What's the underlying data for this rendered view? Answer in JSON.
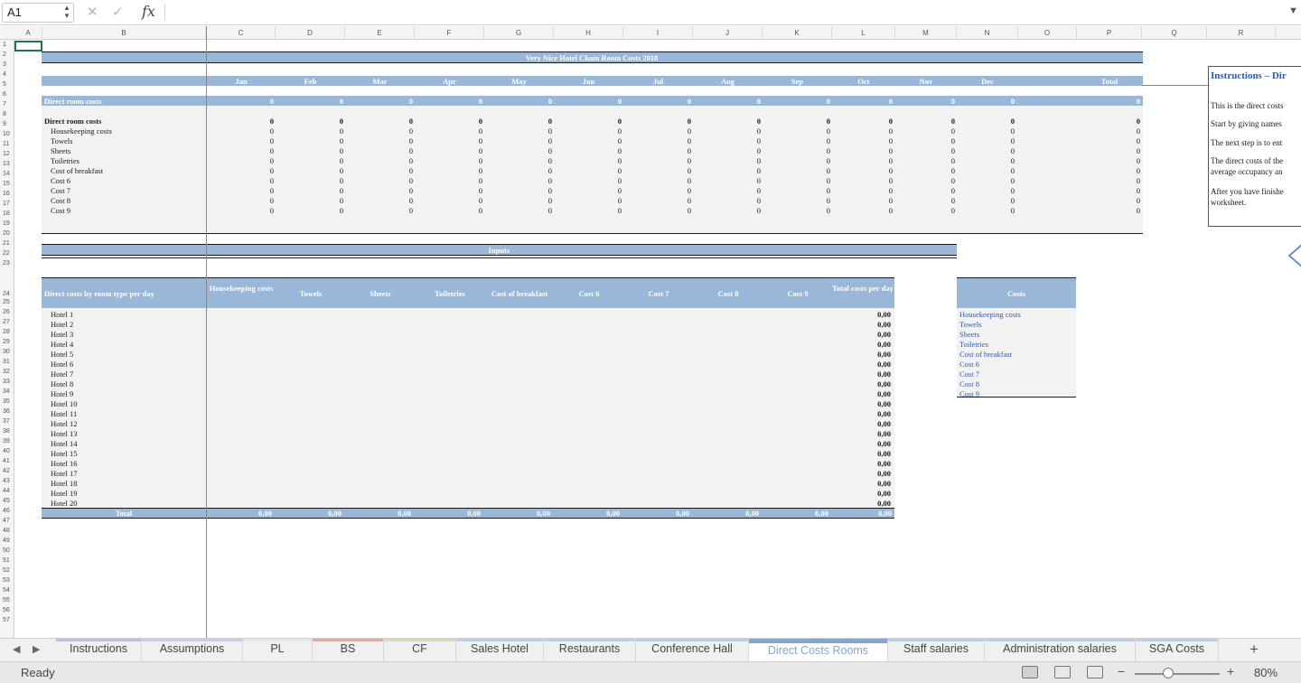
{
  "formula_bar": {
    "cell_ref": "A1",
    "fx_label": "fx",
    "formula": ""
  },
  "columns": [
    "A",
    "B",
    "C",
    "D",
    "E",
    "F",
    "G",
    "H",
    "I",
    "J",
    "K",
    "L",
    "M",
    "N",
    "O",
    "P",
    "Q",
    "R"
  ],
  "rows": [
    "1",
    "2",
    "3",
    "4",
    "5",
    "6",
    "7",
    "8",
    "9",
    "10",
    "11",
    "12",
    "13",
    "14",
    "15",
    "16",
    "17",
    "18",
    "19",
    "20",
    "21",
    "22",
    "23",
    "24",
    "25",
    "26",
    "27",
    "28",
    "29",
    "30",
    "31",
    "32",
    "33",
    "34",
    "35",
    "36",
    "37",
    "38",
    "39",
    "40",
    "41",
    "42",
    "43",
    "44",
    "45",
    "46",
    "47",
    "48",
    "49",
    "50",
    "51",
    "52",
    "53",
    "54",
    "55",
    "56",
    "57"
  ],
  "sheet": {
    "title": "Very Nice Hotel Chain Room Costs 2018",
    "months": [
      "Jan",
      "Feb",
      "Mar",
      "Apr",
      "May",
      "Jun",
      "Jul",
      "Aug",
      "Sep",
      "Oct",
      "Nov",
      "Dec"
    ],
    "total_label": "Total",
    "direct_row_label": "Direct room costs",
    "zero": "0",
    "section_label": "Direct room costs",
    "cost_items": [
      "Housekeeping costs",
      "Towels",
      "Sheets",
      "Toiletries",
      "Cost of breakfast",
      "Cost 6",
      "Cost 7",
      "Cost 8",
      "Cost 9"
    ],
    "inputs_title": "Inputs",
    "inputs_header": "Direct costs by room type per day",
    "input_cols": [
      "Housekeeping costs",
      "Towels",
      "Sheets",
      "Toiletries",
      "Cost of breakfast",
      "Cost 6",
      "Cost 7",
      "Cost 8",
      "Cost 9",
      "Total costs per day"
    ],
    "hotels": [
      "Hotel 1",
      "Hotel 2",
      "Hotel 3",
      "Hotel 4",
      "Hotel 5",
      "Hotel 6",
      "Hotel 7",
      "Hotel 8",
      "Hotel 9",
      "Hotel 10",
      "Hotel 11",
      "Hotel 12",
      "Hotel 13",
      "Hotel 14",
      "Hotel 15",
      "Hotel 16",
      "Hotel 17",
      "Hotel 18",
      "Hotel 19",
      "Hotel 20"
    ],
    "zero_dec": "0,00",
    "inputs_total_label": "Total",
    "costs_header": "Costs",
    "costs_list": [
      "Housekeeping costs",
      "Towels",
      "Sheets",
      "Toiletries",
      "Cost of breakfast",
      "Cost 6",
      "Cost 7",
      "Cost 8",
      "Cost 9"
    ]
  },
  "instructions_box": {
    "title": "Instructions – Dir",
    "lines": [
      "This is the direct costs",
      "Start by giving names",
      "The next step is to ent",
      "The direct costs of the",
      "average occupancy an",
      "After you have finishe",
      "worksheet."
    ]
  },
  "tabs": [
    {
      "label": "Instructions",
      "color": "#c9b8e6"
    },
    {
      "label": "Assumptions",
      "color": "#d9c3ee"
    },
    {
      "label": "PL",
      "color": "#e8e8e8"
    },
    {
      "label": "BS",
      "color": "#f2a39a"
    },
    {
      "label": "CF",
      "color": "#cfe2a8"
    },
    {
      "label": "Sales Hotel",
      "color": "#b9d0ec"
    },
    {
      "label": "Restaurants",
      "color": "#b9d0ec"
    },
    {
      "label": "Conference Hall",
      "color": "#b9d0ec"
    },
    {
      "label": "Direct Costs Rooms",
      "color": "#7fa6d6"
    },
    {
      "label": "Staff salaries",
      "color": "#b9d0ec"
    },
    {
      "label": "Administration salaries",
      "color": "#b9d0ec"
    },
    {
      "label": "SGA Costs",
      "color": "#b9d0ec"
    }
  ],
  "status": {
    "ready": "Ready",
    "zoom": "80%",
    "zoom_minus": "−",
    "zoom_plus": "+"
  },
  "colors": {
    "header_bar": "#9bb7d8",
    "panel": "#f2f2f2",
    "accent": "#217346",
    "link": "#2f5aa8"
  }
}
